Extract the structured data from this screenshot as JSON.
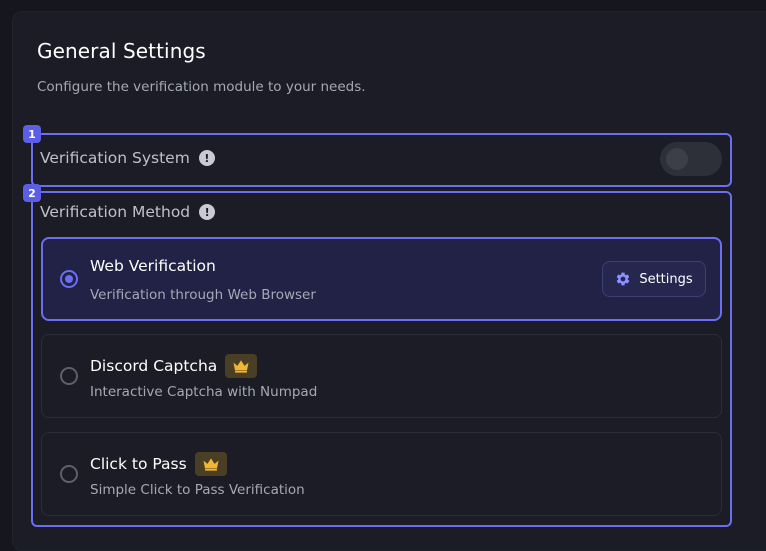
{
  "header": {
    "title": "General Settings",
    "subtitle": "Configure the verification module to your needs."
  },
  "sections": [
    {
      "badge": "1",
      "label": "Verification System",
      "info_icon": "info-icon",
      "toggle_on": false
    },
    {
      "badge": "2",
      "label": "Verification Method",
      "info_icon": "info-icon"
    }
  ],
  "methods": [
    {
      "title": "Web Verification",
      "description": "Verification through Web Browser",
      "selected": true,
      "premium": false,
      "settings_label": "Settings",
      "settings_icon": "gear-icon"
    },
    {
      "title": "Discord Captcha",
      "description": "Interactive Captcha with Numpad",
      "selected": false,
      "premium": true,
      "premium_icon": "crown-icon"
    },
    {
      "title": "Click to Pass",
      "description": "Simple Click to Pass Verification",
      "selected": false,
      "premium": true,
      "premium_icon": "crown-icon"
    }
  ],
  "colors": {
    "accent": "#6a6ef0",
    "background": "#16171e",
    "card": "#1b1c25",
    "premium_gold": "#f2b632"
  }
}
